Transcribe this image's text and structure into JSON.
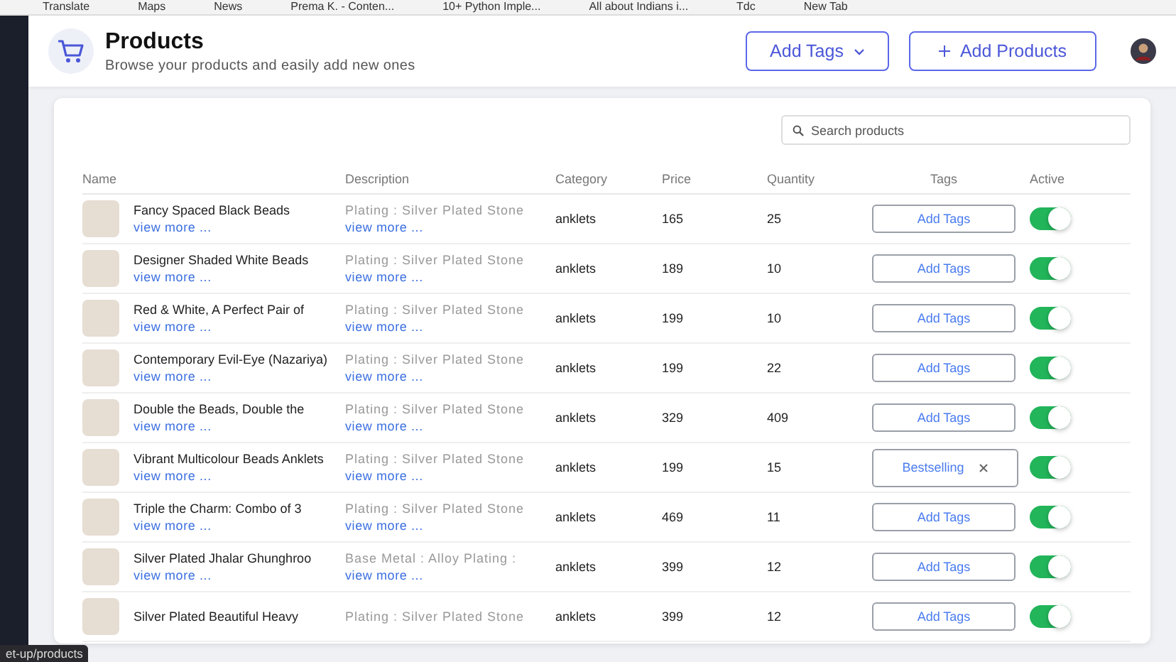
{
  "bookmarks": [
    "Translate",
    "Maps",
    "News",
    "Prema K. - Conten...",
    "10+ Python Imple...",
    "All about Indians i...",
    "Tdc",
    "New Tab"
  ],
  "header": {
    "title": "Products",
    "subtitle": "Browse your products and easily add new ones",
    "buttons": [
      {
        "kind": "dropdown",
        "label": "Add Tags"
      },
      {
        "kind": "add",
        "label": "Add Products"
      }
    ]
  },
  "search": {
    "placeholder": "Search products"
  },
  "table": {
    "columns": [
      "Name",
      "Description",
      "Category",
      "Price",
      "Quantity",
      "Tags",
      "Active"
    ],
    "rows": [
      {
        "name": "Fancy Spaced Black Beads",
        "name_link": "view more ...",
        "description": "Plating : Silver Plated Stone",
        "description_link": "view more ...",
        "category": "anklets",
        "price": "165",
        "quantity": "25",
        "tag": {
          "kind": "button",
          "label": "Add Tags"
        },
        "active": true
      },
      {
        "name": "Designer Shaded White Beads",
        "name_link": "view more ...",
        "description": "Plating : Silver Plated Stone",
        "description_link": "view more ...",
        "category": "anklets",
        "price": "189",
        "quantity": "10",
        "tag": {
          "kind": "button",
          "label": "Add Tags"
        },
        "active": true
      },
      {
        "name": "Red & White, A Perfect Pair of",
        "name_link": "view more ...",
        "description": "Plating : Silver Plated Stone",
        "description_link": "view more ...",
        "category": "anklets",
        "price": "199",
        "quantity": "10",
        "tag": {
          "kind": "button",
          "label": "Add Tags"
        },
        "active": true
      },
      {
        "name": "Contemporary Evil-Eye (Nazariya)",
        "name_link": "view more ...",
        "description": "Plating : Silver Plated Stone",
        "description_link": "view more ...",
        "category": "anklets",
        "price": "199",
        "quantity": "22",
        "tag": {
          "kind": "button",
          "label": "Add Tags"
        },
        "active": true
      },
      {
        "name": "Double the Beads, Double the",
        "name_link": "view more ...",
        "description": "Plating : Silver Plated Stone",
        "description_link": "view more ...",
        "category": "anklets",
        "price": "329",
        "quantity": "409",
        "tag": {
          "kind": "button",
          "label": "Add Tags"
        },
        "active": true
      },
      {
        "name": "Vibrant Multicolour Beads Anklets",
        "name_link": "view more ...",
        "description": "Plating : Silver Plated Stone",
        "description_link": "view more ...",
        "category": "anklets",
        "price": "199",
        "quantity": "15",
        "tag": {
          "kind": "chip",
          "label": "Bestselling"
        },
        "active": true
      },
      {
        "name": "Triple the Charm: Combo of 3",
        "name_link": "view more ...",
        "description": "Plating : Silver Plated Stone",
        "description_link": "view more ...",
        "category": "anklets",
        "price": "469",
        "quantity": "11",
        "tag": {
          "kind": "button",
          "label": "Add Tags"
        },
        "active": true
      },
      {
        "name": "Silver Plated Jhalar Ghunghroo",
        "name_link": "view more ...",
        "description": "Base Metal : Alloy Plating :",
        "description_link": "view more ...",
        "category": "anklets",
        "price": "399",
        "quantity": "12",
        "tag": {
          "kind": "button",
          "label": "Add Tags"
        },
        "active": true
      },
      {
        "name": "Silver Plated Beautiful Heavy",
        "description": "Plating : Silver Plated Stone",
        "category": "anklets",
        "price": "399",
        "quantity": "12",
        "tag": {
          "kind": "button",
          "label": "Add Tags"
        },
        "active": true
      }
    ]
  },
  "status_url": "et-up/products"
}
